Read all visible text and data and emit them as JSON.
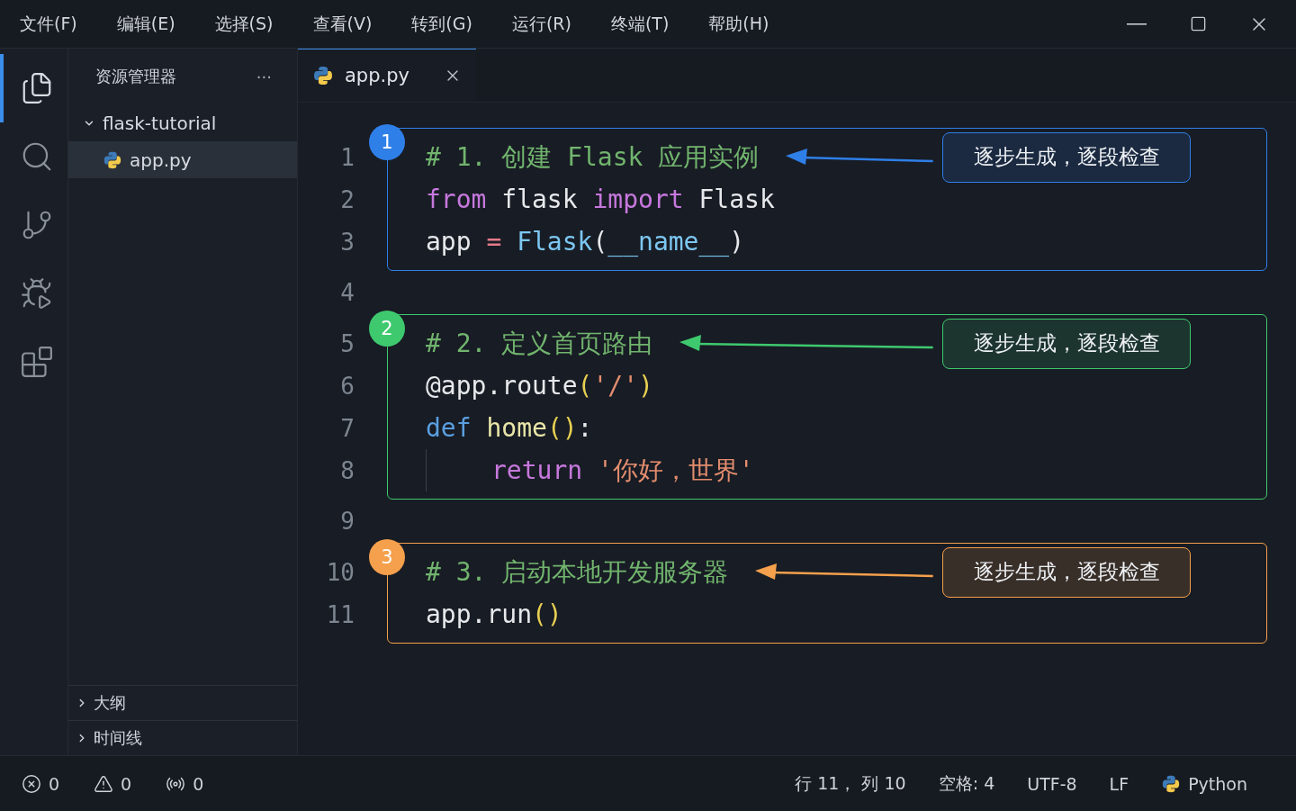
{
  "menu": [
    {
      "label": "文件(F)"
    },
    {
      "label": "编辑(E)"
    },
    {
      "label": "选择(S)"
    },
    {
      "label": "查看(V)"
    },
    {
      "label": "转到(G)"
    },
    {
      "label": "运行(R)"
    },
    {
      "label": "终端(T)"
    },
    {
      "label": "帮助(H)"
    }
  ],
  "activity_bar": [
    {
      "kind": "files",
      "selected": true
    },
    {
      "kind": "search",
      "selected": false
    },
    {
      "kind": "source_control",
      "selected": false
    },
    {
      "kind": "run",
      "selected": false
    },
    {
      "kind": "extensions",
      "selected": false
    }
  ],
  "sidebar": {
    "title": "资源管理器",
    "more": "···",
    "tree": [
      {
        "label": "flask-tutorial",
        "expanded": true,
        "children": [
          {
            "label": "app.py",
            "selected": true
          }
        ]
      }
    ],
    "sections": [
      {
        "label": "大纲",
        "expanded": false
      },
      {
        "label": "时间线",
        "expanded": false
      }
    ]
  },
  "tabs": [
    {
      "label": "app.py",
      "selected": true
    }
  ],
  "editor": {
    "rows": [
      {
        "kind": "block",
        "badge": "1",
        "color": "#2f7fe8",
        "note": "逐步生成，逐段检查",
        "lines": [
          {
            "number": "1",
            "tokens": [
              {
                "kind": "comment",
                "text": "# 1. 创建 Flask 应用实例"
              }
            ]
          },
          {
            "number": "2",
            "tokens": [
              {
                "kind": "keyword",
                "text": "from"
              },
              {
                "kind": "plain",
                "text": " flask "
              },
              {
                "kind": "keyword",
                "text": "import"
              },
              {
                "kind": "plain",
                "text": " Flask"
              }
            ]
          },
          {
            "number": "3",
            "tokens": [
              {
                "kind": "plain",
                "text": "app "
              },
              {
                "kind": "operator",
                "text": "= "
              },
              {
                "kind": "class",
                "text": "Flask"
              },
              {
                "kind": "plain",
                "text": "("
              },
              {
                "kind": "class",
                "text": "__name__"
              },
              {
                "kind": "plain",
                "text": ")"
              }
            ]
          }
        ]
      },
      {
        "kind": "blank",
        "number": "4"
      },
      {
        "kind": "block",
        "badge": "2",
        "color": "#3ec96f",
        "note": "逐步生成，逐段检查",
        "lines": [
          {
            "number": "5",
            "tokens": [
              {
                "kind": "comment",
                "text": "# 2. 定义首页路由"
              }
            ]
          },
          {
            "number": "6",
            "tokens": [
              {
                "kind": "plain",
                "text": "@app.route"
              },
              {
                "kind": "paren",
                "text": "("
              },
              {
                "kind": "string",
                "text": "'/'"
              },
              {
                "kind": "paren",
                "text": ")"
              }
            ]
          },
          {
            "number": "7",
            "tokens": [
              {
                "kind": "def",
                "text": "def "
              },
              {
                "kind": "func",
                "text": "home"
              },
              {
                "kind": "paren",
                "text": "()"
              },
              {
                "kind": "plain",
                "text": ":"
              }
            ]
          },
          {
            "number": "8",
            "indented": true,
            "tokens": [
              {
                "kind": "keyword",
                "text": "return "
              },
              {
                "kind": "string",
                "text": "'你好，世界'"
              }
            ]
          }
        ]
      },
      {
        "kind": "blank",
        "number": "9"
      },
      {
        "kind": "block",
        "badge": "3",
        "color": "#f5a04c",
        "note": "逐步生成，逐段检查",
        "lines": [
          {
            "number": "10",
            "tokens": [
              {
                "kind": "comment",
                "text": "# 3. 启动本地开发服务器"
              }
            ]
          },
          {
            "number": "11",
            "tokens": [
              {
                "kind": "plain",
                "text": "app.run"
              },
              {
                "kind": "paren",
                "text": "()"
              }
            ]
          }
        ]
      }
    ]
  },
  "status_bar": {
    "left": [
      {
        "kind": "errors",
        "count": "0"
      },
      {
        "kind": "warnings",
        "count": "0"
      },
      {
        "kind": "ports",
        "count": "0"
      }
    ],
    "right": [
      {
        "text": "行 11， 列 10"
      },
      {
        "text": "空格: 4"
      },
      {
        "text": "UTF-8"
      },
      {
        "text": "LF"
      }
    ],
    "language": "Python"
  }
}
